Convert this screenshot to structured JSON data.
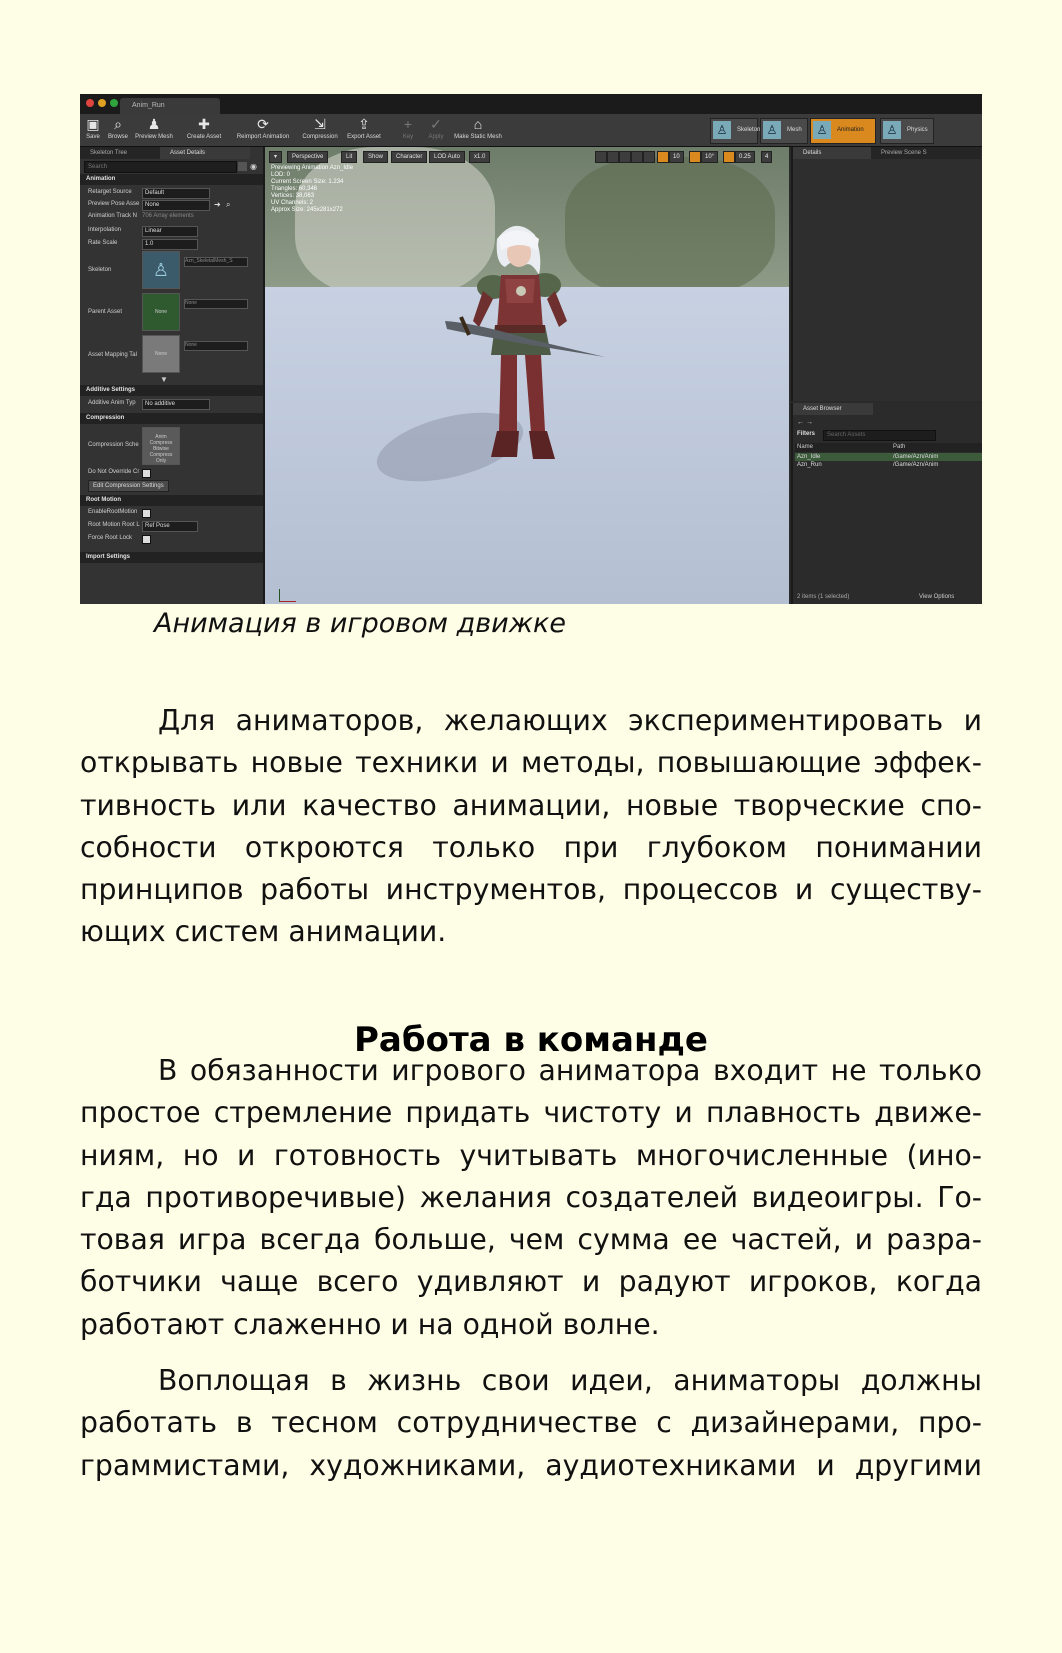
{
  "editor": {
    "tab_title": "Anim_Run",
    "toolbar": {
      "buttons": [
        {
          "label": "Save",
          "icon": "save-icon",
          "glyph": "▣",
          "enabled": true
        },
        {
          "label": "Browse",
          "icon": "search-icon",
          "glyph": "⌕",
          "enabled": true
        },
        {
          "label": "Preview Mesh",
          "icon": "mesh-icon",
          "glyph": "♟",
          "enabled": true
        },
        {
          "label": "Create Asset",
          "icon": "create-asset-icon",
          "glyph": "✚",
          "enabled": true
        },
        {
          "label": "Reimport Animation",
          "icon": "reimport-icon",
          "glyph": "⟳",
          "enabled": true
        },
        {
          "label": "Compression",
          "icon": "compression-icon",
          "glyph": "⇲",
          "enabled": true
        },
        {
          "label": "Export Asset",
          "icon": "export-icon",
          "glyph": "⇪",
          "enabled": true
        },
        {
          "label": "Key",
          "icon": "key-icon",
          "glyph": "+",
          "enabled": false
        },
        {
          "label": "Apply",
          "icon": "apply-icon",
          "glyph": "✓",
          "enabled": false
        },
        {
          "label": "Make Static Mesh",
          "icon": "static-mesh-icon",
          "glyph": "⌂",
          "enabled": true
        }
      ],
      "modes": [
        {
          "label": "Skeleton",
          "icon": "skeleton-icon",
          "active": false
        },
        {
          "label": "Mesh",
          "icon": "mesh-mode-icon",
          "active": false
        },
        {
          "label": "Animation",
          "icon": "animation-mode-icon",
          "active": true
        },
        {
          "label": "Physics",
          "icon": "physics-mode-icon",
          "active": false
        }
      ]
    },
    "left_panel": {
      "tabs": [
        "Skeleton Tree",
        "Asset Details"
      ],
      "search_placeholder": "Search",
      "sections": {
        "animation": "Animation",
        "additive": "Additive Settings",
        "compression": "Compression",
        "root_motion": "Root Motion",
        "import": "Import Settings"
      },
      "rows": {
        "retarget_source": {
          "label": "Retarget Source",
          "value": "Default"
        },
        "preview_pose": {
          "label": "Preview Pose Asse",
          "value": "None"
        },
        "animation_track": {
          "label": "Animation Track N",
          "value": "706 Array elements"
        },
        "interpolation": {
          "label": "Interpolation",
          "value": "Linear"
        },
        "rate_scale": {
          "label": "Rate Scale",
          "value": "1.0"
        },
        "skeleton": {
          "label": "Skeleton",
          "value": "Azn_SkeletalMesh_S"
        },
        "parent_asset": {
          "label": "Parent Asset",
          "value": "None",
          "thumb": "None"
        },
        "asset_mapping": {
          "label": "Asset Mapping Tal",
          "value": "None",
          "thumb": "None"
        },
        "additive_anim_type": {
          "label": "Additive Anim Typ",
          "value": "No additive"
        },
        "compression_scheme": {
          "label": "Compression Sche",
          "value": "Anim Compress Bitwise Compress Only"
        },
        "do_not_override": {
          "label": "Do Not Override Cr"
        },
        "edit_compression": "Edit Compression Settings",
        "enable_root_motion": {
          "label": "EnableRootMotion"
        },
        "root_motion_lock": {
          "label": "Root Motion Root L",
          "value": "Ref Pose"
        },
        "force_root_lock": {
          "label": "Force Root Lock"
        }
      }
    },
    "viewport": {
      "buttons": [
        "Perspective",
        "Lit",
        "Show",
        "Character",
        "LOD Auto",
        "x1.0"
      ],
      "stats": [
        "Previewing Animation Azn_Idle",
        "LOD: 0",
        "Current Screen Size: 1.234",
        "Triangles: 60,346",
        "Vertices: 38,063",
        "UV Channels: 2",
        "Approx Size: 245x281x272"
      ],
      "snap_values": [
        "10",
        "10°",
        "0.25",
        "4"
      ]
    },
    "right_panel": {
      "tabs": [
        "Details",
        "Preview Scene S"
      ],
      "asset_browser": {
        "tab": "Asset Browser",
        "filters_label": "Filters",
        "search_placeholder": "Search Assets",
        "columns": [
          "Name",
          "Path"
        ],
        "rows": [
          {
            "name": "Azn_Idle",
            "path": "/Game/Azn/Anim"
          },
          {
            "name": "Azn_Run",
            "path": "/Game/Azn/Anim"
          }
        ],
        "footer": "2 items (1 selected)",
        "view_options": "View Options"
      }
    },
    "colors": {
      "accent_orange": "#d9891e",
      "panel_dark": "#2a2a2a"
    }
  },
  "caption": "Анимация в игровом движке",
  "paragraph1": [
    "Для аниматоров, желающих экспериментировать и",
    "открывать новые техники и методы, повышающие эффек-",
    "тивность или качество анимации, новые творческие спо-",
    "собности откроются только при глубоком понимании",
    "принципов работы инструментов, процессов и существу-",
    "ющих систем анимации."
  ],
  "heading": "Работа в команде",
  "paragraph2": [
    "В обязанности игрового аниматора входит не только",
    "простое стремление придать чистоту и плавность движе-",
    "ниям, но и готовность учитывать многочисленные (ино-",
    "гда противоречивые) желания создателей видеоигры. Го-",
    "товая игра всегда больше, чем сумма ее частей, и разра-",
    "ботчики чаще всего удивляют и радуют игроков, когда",
    "работают слаженно и на одной волне."
  ],
  "paragraph3": [
    "Воплощая в жизнь свои идеи, аниматоры должны",
    "работать в тесном сотрудничестве с дизайнерами, про-",
    "граммистами, художниками, аудиотехниками и другими"
  ]
}
